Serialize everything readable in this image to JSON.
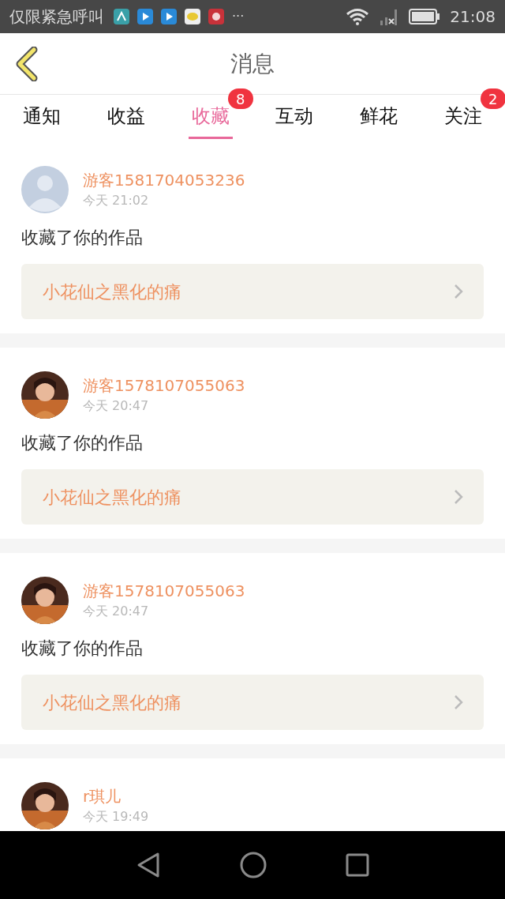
{
  "status_bar": {
    "carrier": "仅限紧急呼叫",
    "more": "···",
    "time": "21:08"
  },
  "header": {
    "title": "消息"
  },
  "tabs": [
    {
      "label": "通知",
      "selected": false
    },
    {
      "label": "收益",
      "selected": false
    },
    {
      "label": "收藏",
      "selected": true,
      "badge": "8"
    },
    {
      "label": "互动",
      "selected": false
    },
    {
      "label": "鲜花",
      "selected": false
    },
    {
      "label": "关注",
      "selected": false,
      "badge": "2"
    }
  ],
  "messages": [
    {
      "avatar": {
        "kind": "default"
      },
      "name": "游客1581704053236",
      "time": "今天 21:02",
      "text": "收藏了你的作品",
      "work": "小花仙之黑化的痛"
    },
    {
      "name": "游客1578107055063",
      "time": "今天 20:47",
      "text": "收藏了你的作品",
      "work": "小花仙之黑化的痛"
    },
    {
      "name": "游客1578107055063",
      "time": "今天 20:47",
      "text": "收藏了你的作品",
      "work": "小花仙之黑化的痛"
    },
    {
      "name": "r琪儿",
      "time": "今天 19:49"
    }
  ]
}
